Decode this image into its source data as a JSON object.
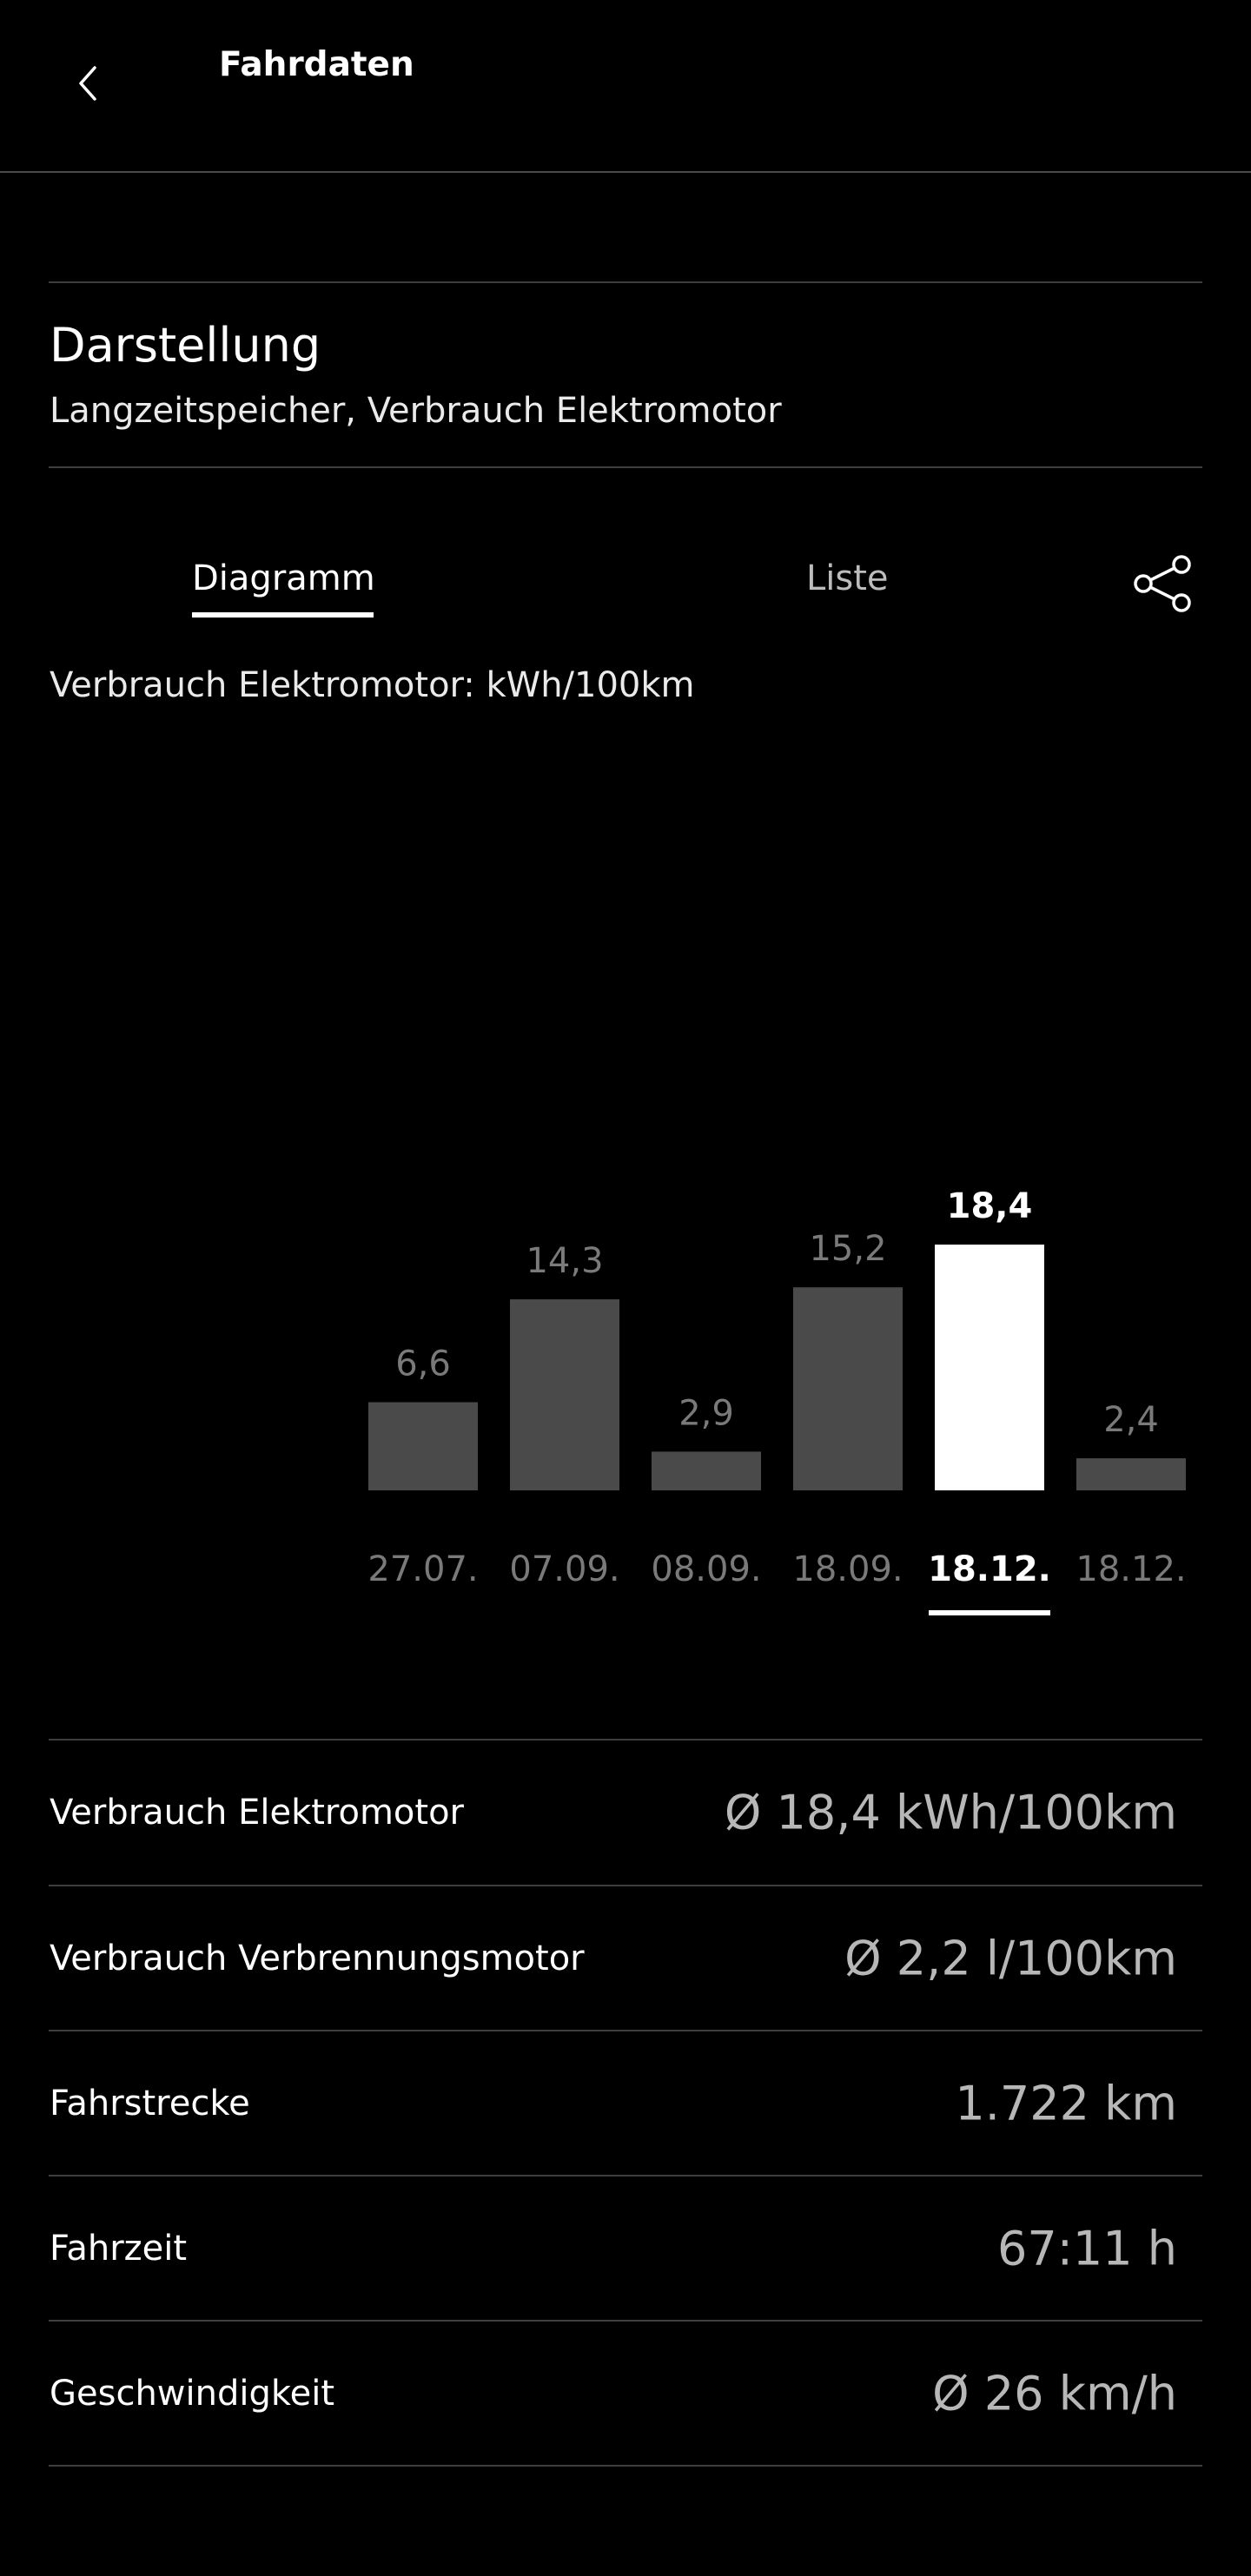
{
  "header": {
    "title": "Fahrdaten"
  },
  "darstellung": {
    "title": "Darstellung",
    "subtitle": "Langzeitspeicher, Verbrauch Elektromotor"
  },
  "tabs": [
    {
      "label": "Diagramm",
      "active": true
    },
    {
      "label": "Liste",
      "active": false
    }
  ],
  "chart_label": "Verbrauch Elektromotor: kWh/100km",
  "chart_data": {
    "type": "bar",
    "categories": [
      "27.07.",
      "07.09.",
      "08.09.",
      "18.09.",
      "18.12.",
      "18.12."
    ],
    "values": [
      6.6,
      14.3,
      2.9,
      15.2,
      18.4,
      2.4
    ],
    "value_labels": [
      "6,6",
      "14,3",
      "2,9",
      "15,2",
      "18,4",
      "2,4"
    ],
    "selected_index": 4,
    "title": "Verbrauch Elektromotor: kWh/100km",
    "xlabel": "",
    "ylabel": "",
    "ylim": [
      0,
      18.4
    ],
    "grid": false,
    "colors": {
      "bar": "#4a4a4a",
      "selected_bar": "#ffffff",
      "label": "#7a7a7a",
      "selected_label": "#ffffff"
    }
  },
  "stats": [
    {
      "label": "Verbrauch Elektromotor",
      "value": "Ø 18,4 kWh/100km"
    },
    {
      "label": "Verbrauch Verbrennungsmotor",
      "value": "Ø 2,2 l/100km"
    },
    {
      "label": "Fahrstrecke",
      "value": "1.722 km"
    },
    {
      "label": "Fahrzeit",
      "value": "67:11 h"
    },
    {
      "label": "Geschwindigkeit",
      "value": "Ø 26 km/h"
    }
  ],
  "icons": {
    "back": "chevron-left-icon",
    "share": "share-icon"
  }
}
